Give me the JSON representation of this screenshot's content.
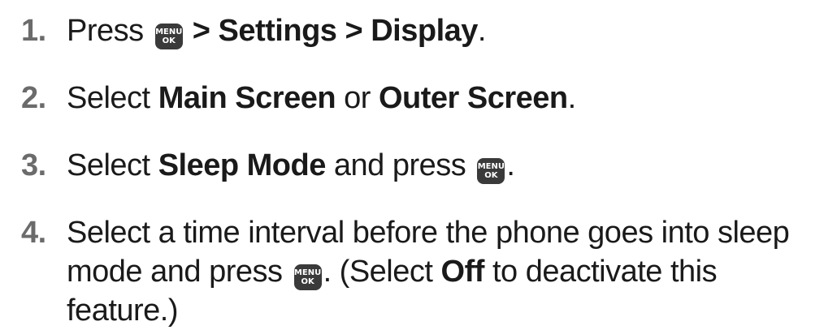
{
  "key_icon": {
    "line1": "MENU",
    "line2": "OK",
    "name": "menu-ok-key-icon"
  },
  "steps": [
    {
      "number": "1.",
      "text_press": "Press",
      "path": "> Settings > Display",
      "end": "."
    },
    {
      "number": "2.",
      "text_select": "Select",
      "option_a": "Main Screen",
      "text_or": "or",
      "option_b": "Outer Screen",
      "end": "."
    },
    {
      "number": "3.",
      "text_select": "Select",
      "option": "Sleep Mode",
      "text_and_press": "and press",
      "end": "."
    },
    {
      "number": "4.",
      "text_main": "Select a time interval before the phone goes into sleep mode and press",
      "text_after_key": ". (Select",
      "option_off": "Off",
      "text_tail": "to deactivate this feature.)"
    }
  ]
}
